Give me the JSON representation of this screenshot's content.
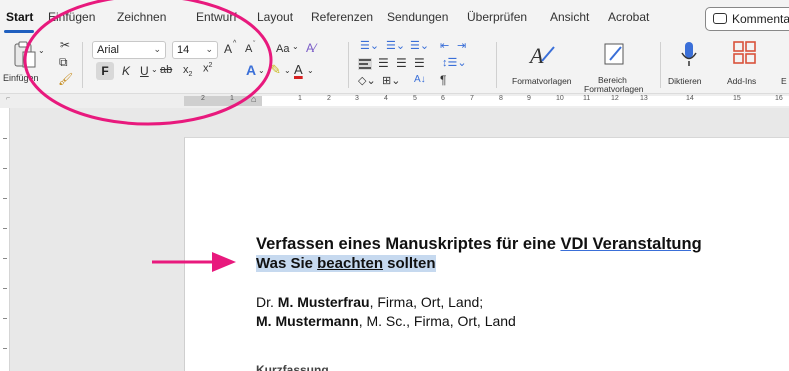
{
  "menu": {
    "tabs": [
      "Start",
      "Einfügen",
      "Zeichnen",
      "Entwurf",
      "Layout",
      "Referenzen",
      "Sendungen",
      "Überprüfen",
      "Ansicht",
      "Acrobat"
    ],
    "comments_label": "Kommentar"
  },
  "ribbon": {
    "paste_label": "Einfügen",
    "font_name": "Arial",
    "font_size": "14",
    "grow_font": "A",
    "shrink_font": "A",
    "change_case": "Aa",
    "bold": "F",
    "italic": "K",
    "underline": "U",
    "strikethrough": "ab",
    "subscript": "x",
    "superscript": "x",
    "sort": "A↓",
    "pilcrow": "¶",
    "styles_label": "Formatvorlagen",
    "styles_pane_label_1": "Bereich",
    "styles_pane_label_2": "Formatvorlagen",
    "dictate_label": "Diktieren",
    "addins_label": "Add-Ins",
    "cut_label": "E"
  },
  "ruler": {
    "numbers": [
      "2",
      "1",
      "1",
      "2",
      "3",
      "4",
      "5",
      "6",
      "7",
      "8",
      "9",
      "10",
      "11",
      "12",
      "13",
      "14",
      "15",
      "16"
    ]
  },
  "document": {
    "title_line1_pre": "Verfassen eines Manuskriptes für eine ",
    "title_line1_link": "VDI Veranstaltung",
    "title_line2_pre": "Was Sie ",
    "title_line2_ul": "beachten",
    "title_line2_post": " sollten",
    "author1_pre": "Dr. ",
    "author1_bold": "M. Musterfrau",
    "author1_post": ", Firma, Ort, Land;",
    "author2_bold": "M. Mustermann",
    "author2_post": ", M. Sc., Firma, Ort, Land",
    "next_heading_partial": "Kurzfassung"
  },
  "annotations": {
    "circle_color": "#e8197d",
    "arrow_color": "#e8197d"
  }
}
